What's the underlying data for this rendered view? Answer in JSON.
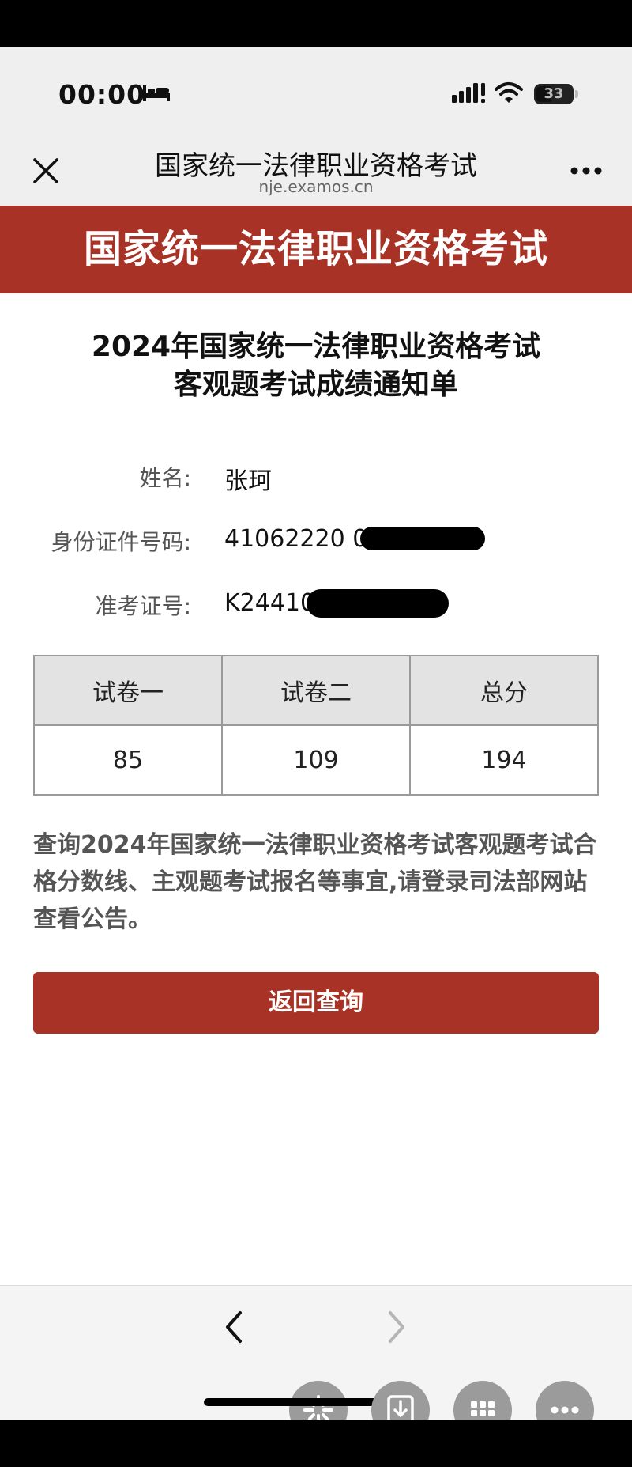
{
  "status_bar": {
    "time": "00:00",
    "battery_level": "33",
    "icons": [
      "bed-icon",
      "signal-icon",
      "wifi-icon",
      "battery-icon"
    ]
  },
  "browser": {
    "title": "国家统一法律职业资格考试",
    "url": "nje.examos.cn",
    "icons": [
      "close-icon",
      "more-icon"
    ]
  },
  "banner": {
    "title": "国家统一法律职业资格考试"
  },
  "report": {
    "heading_line1": "2024年国家统一法律职业资格考试",
    "heading_line2": "客观题考试成绩通知单",
    "fields": [
      {
        "label": "姓名:",
        "value": "张珂"
      },
      {
        "label": "身份证件号码:",
        "value": "41062220 0"
      },
      {
        "label": "准考证号:",
        "value": "K24410"
      }
    ],
    "table": {
      "headers": [
        "试卷一",
        "试卷二",
        "总分"
      ],
      "rows": [
        [
          "85",
          "109",
          "194"
        ]
      ]
    },
    "notice": "查询2024年国家统一法律职业资格考试客观题考试合格分数线、主观题考试报名等事宜,请登录司法部网站查看公告。",
    "back_button_label": "返回查询"
  },
  "bottom_bar": {
    "icons": [
      "back-arrow-icon",
      "forward-arrow-icon",
      "sparkle-icon",
      "download-icon",
      "grid-icon",
      "more-icon"
    ]
  },
  "colors": {
    "brand_red": "#a93226",
    "chrome_gray": "#efefef"
  }
}
